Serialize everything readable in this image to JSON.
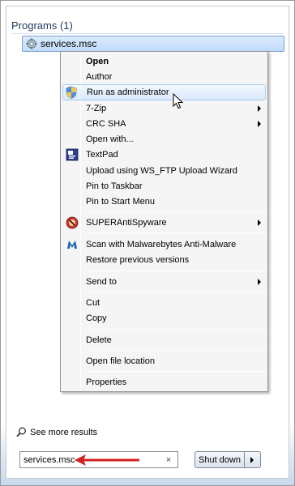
{
  "programs": {
    "header": "Programs (1)",
    "result": "services.msc",
    "result_icon": "services-gear-icon"
  },
  "context_menu": {
    "items": [
      {
        "label": "Open",
        "bold": true
      },
      {
        "label": "Author"
      },
      {
        "label": "Run as administrator",
        "icon": "uac-shield-icon",
        "highlighted": true
      },
      {
        "label": "7-Zip",
        "submenu": true
      },
      {
        "label": "CRC SHA",
        "submenu": true
      },
      {
        "label": "Open with..."
      },
      {
        "label": "TextPad",
        "icon": "textpad-icon"
      },
      {
        "label": "Upload using WS_FTP Upload Wizard"
      },
      {
        "label": "Pin to Taskbar"
      },
      {
        "label": "Pin to Start Menu"
      },
      {
        "label": "SUPERAntiSpyware",
        "icon": "superantispyware-icon",
        "submenu": true
      },
      {
        "label": "Scan with Malwarebytes Anti-Malware",
        "icon": "malwarebytes-icon"
      },
      {
        "label": "Restore previous versions"
      },
      {
        "label": "Send to",
        "submenu": true
      },
      {
        "label": "Cut"
      },
      {
        "label": "Copy"
      },
      {
        "label": "Delete"
      },
      {
        "label": "Open file location"
      },
      {
        "label": "Properties"
      }
    ]
  },
  "see_more": "See more results",
  "search": {
    "value": "services.msc",
    "clear": "×"
  },
  "shutdown": {
    "label": "Shut down"
  },
  "colors": {
    "highlight": "#dbeafc",
    "annotation_arrow": "#d32020"
  }
}
